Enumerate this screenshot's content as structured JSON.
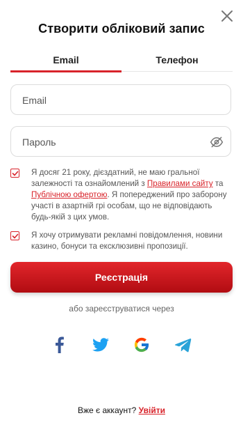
{
  "header": {
    "title": "Створити обліковий запис",
    "close_icon": "close-icon"
  },
  "tabs": [
    {
      "label": "Email",
      "active": true
    },
    {
      "label": "Телефон",
      "active": false
    }
  ],
  "form": {
    "email_placeholder": "Email",
    "email_value": "",
    "password_placeholder": "Пароль",
    "password_value": "",
    "password_toggle_icon": "eye-off-icon"
  },
  "consents": {
    "age": {
      "checked": true,
      "text_1": "Я досяг 21 року, дієздатний, не маю гральної залежності та ознайомлений з ",
      "link_1": "Правилами сайту",
      "text_2": " та ",
      "link_2": "Публічною офертою",
      "text_3": ". Я попереджений про заборону участі в азартній грі особам, що не відповідають будь-якій з цих умов."
    },
    "marketing": {
      "checked": true,
      "text": "Я хочу отримувати рекламні повідомлення, новини казино, бонуси та ексклюзивні пропозиції."
    }
  },
  "register_button": "Реєстрація",
  "social": {
    "label": "або зареєструватися через",
    "icons": [
      "facebook-icon",
      "twitter-icon",
      "google-icon",
      "telegram-icon"
    ]
  },
  "footer": {
    "prompt": "Вже є аккаунт? ",
    "login_link": "Увійти"
  },
  "colors": {
    "accent": "#d8232a",
    "facebook": "#3b5998",
    "twitter": "#1da1f2",
    "telegram": "#2aa3d8"
  }
}
